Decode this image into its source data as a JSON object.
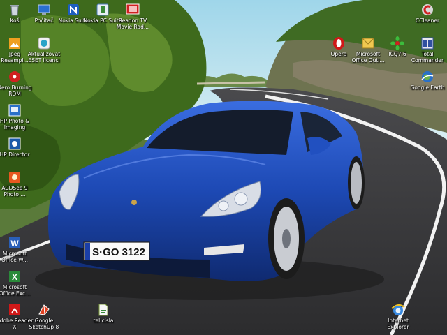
{
  "desktop": {
    "icons": [
      {
        "label": "Koš",
        "icon": "recycle-bin-icon"
      },
      {
        "label": "Počítač",
        "icon": "computer-icon"
      },
      {
        "label": "Nokia Suite",
        "icon": "nokia-suite-icon"
      },
      {
        "label": "Nokia PC Suite",
        "icon": "nokia-pc-suite-icon"
      },
      {
        "label": "Readon TV Movie Rad...",
        "icon": "readon-tv-icon"
      },
      {
        "label": "CCleaner",
        "icon": "ccleaner-icon"
      },
      {
        "label": "Jpeg Resampl...",
        "icon": "jpeg-resampler-icon"
      },
      {
        "label": "Aktualizovat ESET licenci",
        "icon": "eset-icon"
      },
      {
        "label": "Opera",
        "icon": "opera-icon"
      },
      {
        "label": "Microsoft Office Outl...",
        "icon": "outlook-icon"
      },
      {
        "label": "ICQ7.6",
        "icon": "icq-icon"
      },
      {
        "label": "Total Commander",
        "icon": "total-commander-icon"
      },
      {
        "label": "Nero Burning ROM",
        "icon": "nero-icon"
      },
      {
        "label": "Google Earth",
        "icon": "google-earth-icon"
      },
      {
        "label": "HP Photo & Imaging",
        "icon": "hp-photo-icon"
      },
      {
        "label": "HP Director",
        "icon": "hp-director-icon"
      },
      {
        "label": "ACDSee 9 Photo ...",
        "icon": "acdsee-icon"
      },
      {
        "label": "Microsoft Office W...",
        "icon": "word-icon"
      },
      {
        "label": "Microsoft Office Exc...",
        "icon": "excel-icon"
      },
      {
        "label": "Adobe Reader X",
        "icon": "adobe-reader-icon"
      },
      {
        "label": "Google SketchUp 8",
        "icon": "sketchup-icon"
      },
      {
        "label": "tel cisla",
        "icon": "text-file-icon"
      },
      {
        "label": "Internet Explorer",
        "icon": "internet-explorer-icon"
      }
    ]
  },
  "wallpaper": {
    "plate": "S·GO 3122"
  },
  "colors": {
    "car": "#1f4fb8",
    "sky": "#a9dcec",
    "road": "#3d3d3f",
    "foliage": "#3e6a1c"
  }
}
